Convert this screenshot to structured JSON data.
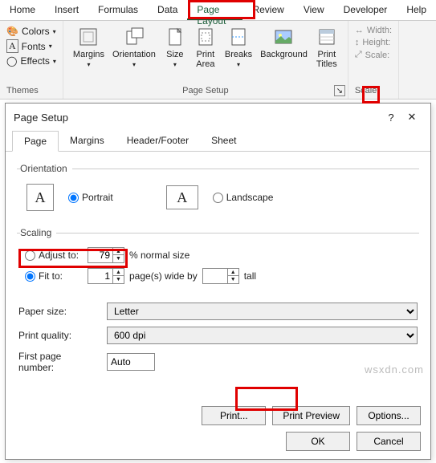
{
  "ribbon": {
    "tabs": [
      "Home",
      "Insert",
      "Formulas",
      "Data",
      "Page Layout",
      "Review",
      "View",
      "Developer",
      "Help"
    ],
    "active_tab": "Page Layout",
    "themes": {
      "colors": "Colors",
      "fonts": "Fonts",
      "effects": "Effects",
      "label": "Themes"
    },
    "page_setup": {
      "margins": "Margins",
      "orientation": "Orientation",
      "size": "Size",
      "print_area": "Print\nArea",
      "breaks": "Breaks",
      "background": "Background",
      "print_titles": "Print\nTitles",
      "label": "Page Setup"
    },
    "scale": {
      "width": "Width:",
      "height": "Height:",
      "scale": "Scale:",
      "label": "Scale"
    }
  },
  "dialog": {
    "title": "Page Setup",
    "tabs": [
      "Page",
      "Margins",
      "Header/Footer",
      "Sheet"
    ],
    "active": "Page",
    "orientation": {
      "legend": "Orientation",
      "portrait": "Portrait",
      "landscape": "Landscape",
      "selected": "portrait"
    },
    "scaling": {
      "legend": "Scaling",
      "adjust_label": "Adjust to:",
      "adjust_val": "79",
      "adjust_suffix": "% normal size",
      "fit_label": "Fit to:",
      "fit_wide": "1",
      "fit_mid": "page(s) wide by",
      "fit_tall": "",
      "fit_suffix": "tall",
      "selected": "fit"
    },
    "paper_label": "Paper size:",
    "paper_val": "Letter",
    "quality_label": "Print quality:",
    "quality_val": "600 dpi",
    "firstpage_label": "First page number:",
    "firstpage_val": "Auto",
    "buttons": {
      "print": "Print...",
      "preview": "Print Preview",
      "options": "Options...",
      "ok": "OK",
      "cancel": "Cancel"
    }
  },
  "watermark": "wsxdn.com"
}
